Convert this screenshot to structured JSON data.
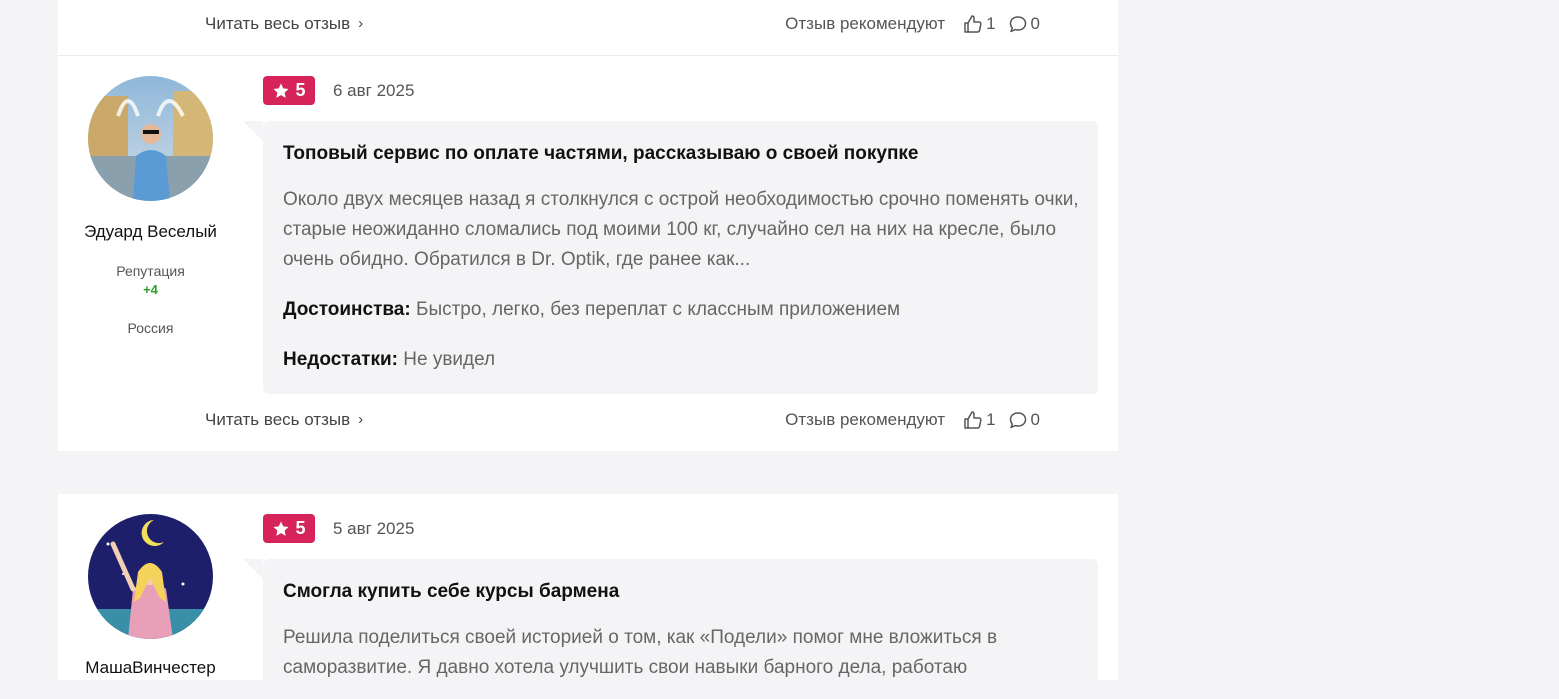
{
  "prev_review": {
    "read_more": "Читать весь отзыв",
    "recommend_label": "Отзыв рекомендуют",
    "likes": "1",
    "comments": "0"
  },
  "reviews": [
    {
      "author": "Эдуард Веселый",
      "reputation_label": "Репутация",
      "reputation_value": "+4",
      "country": "Россия",
      "rating": "5",
      "date": "6 авг 2025",
      "title": "Топовый сервис по оплате частями, рассказываю о своей покупке",
      "text": "Около двух месяцев назад я столкнулся с острой необходимостью срочно поменять очки, старые неожиданно сломались под моими 100 кг, случайно сел на них на кресле, было очень обидно. Обратился в Dr. Optik, где ранее как...",
      "pros_label": "Достоинства:",
      "pros": "Быстро, легко, без переплат с классным приложением",
      "cons_label": "Недостатки:",
      "cons": "Не увидел",
      "read_more": "Читать весь отзыв",
      "recommend_label": "Отзыв рекомендуют",
      "likes": "1",
      "comments": "0"
    },
    {
      "author": "МашаВинчестер",
      "rating": "5",
      "date": "5 авг 2025",
      "title": "Смогла купить себе курсы бармена",
      "text": "Решила поделиться своей историей о том, как «Подели» помог мне вложиться в саморазвитие. Я давно хотела улучшить свои навыки барного дела, работаю"
    }
  ],
  "icons": {
    "chevron": "chevron-right-icon",
    "like": "thumbs-up-icon",
    "comment": "comment-icon",
    "star": "star-icon"
  },
  "colors": {
    "rating_badge": "#d6245a",
    "reputation": "#2aa02a",
    "background": "#f4f4f6"
  }
}
